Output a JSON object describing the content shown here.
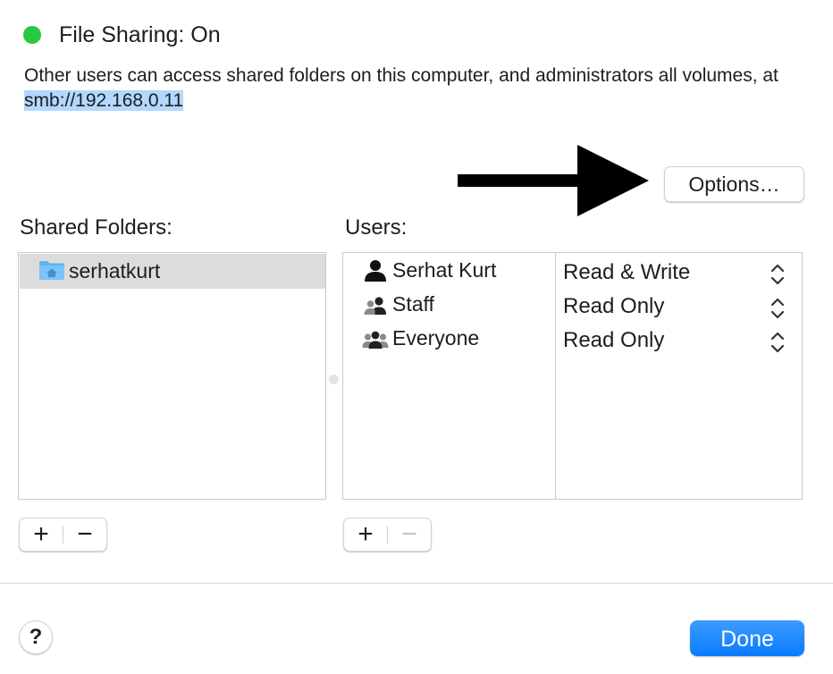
{
  "status": {
    "indicator_color": "#28c840",
    "title": "File Sharing: On",
    "description_prefix": "Other users can access shared folders on this computer, and administrators all volumes, at ",
    "address": "smb://192.168.0.11"
  },
  "options_button": {
    "label": "Options…"
  },
  "shared_folders": {
    "label": "Shared Folders:",
    "items": [
      {
        "name": "serhatkurt",
        "icon": "home-folder-icon",
        "selected": true
      }
    ],
    "add_label": "+",
    "remove_label": "−"
  },
  "users": {
    "label": "Users:",
    "items": [
      {
        "name": "Serhat Kurt",
        "icon": "user-icon",
        "permission": "Read & Write"
      },
      {
        "name": "Staff",
        "icon": "group-icon",
        "permission": "Read Only"
      },
      {
        "name": "Everyone",
        "icon": "everyone-icon",
        "permission": "Read Only"
      }
    ],
    "add_label": "+",
    "remove_label": "−"
  },
  "footer": {
    "help_label": "?",
    "done_label": "Done",
    "done_color": "#0a7bff"
  }
}
